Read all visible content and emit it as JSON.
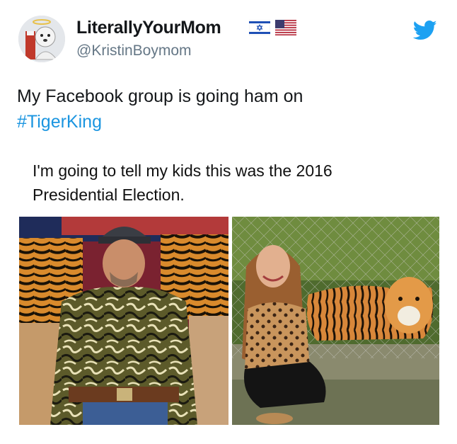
{
  "user": {
    "display_name": "LiterallyYourMom",
    "handle": "@KristinBoymom",
    "flags": [
      "israel-flag-icon",
      "usa-flag-icon"
    ],
    "avatar": "cartoon-avatar"
  },
  "brand": {
    "icon": "twitter-bird-icon",
    "color": "#1da1f2"
  },
  "tweet": {
    "text": "My Facebook group is going ham on",
    "hashtag": "#TigerKing",
    "hashtag_color": "#1b95e0"
  },
  "quoted_post": {
    "text_line1": "I'm going to tell my kids this was the 2016",
    "text_line2": "Presidential Election."
  },
  "photos": [
    {
      "name": "man-in-leopard-shirt-with-tigers-photo"
    },
    {
      "name": "woman-kneeling-by-tiger-photo"
    }
  ]
}
